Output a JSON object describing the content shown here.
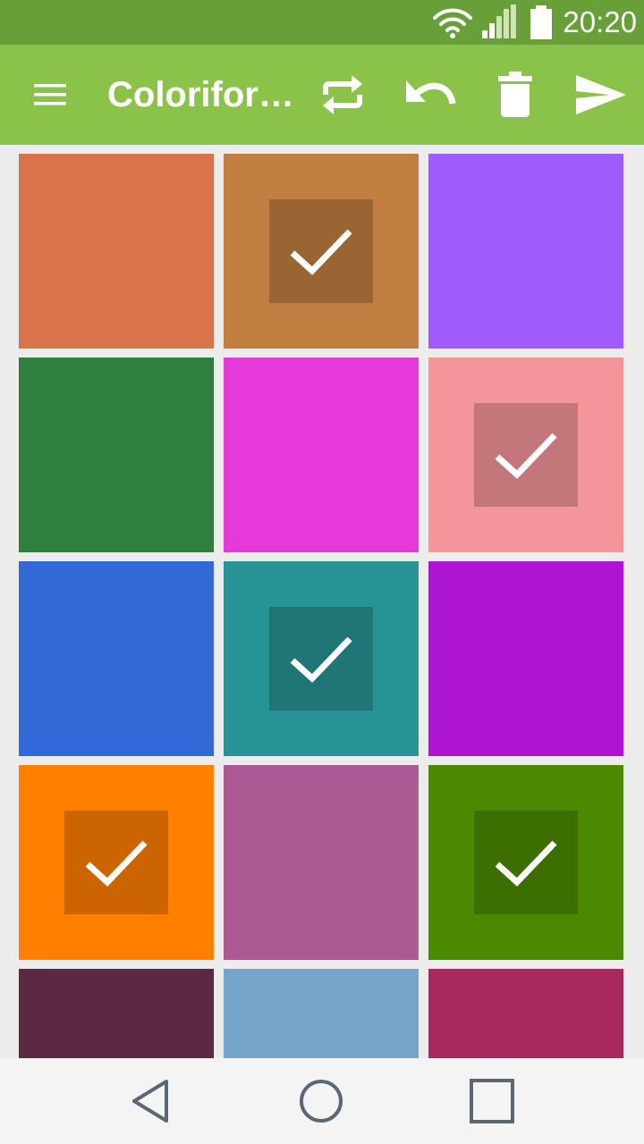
{
  "status_bar": {
    "time": "20:20",
    "icons": [
      "wifi-icon",
      "signal-icon",
      "battery-icon"
    ]
  },
  "app_bar": {
    "title": "Coloriform…",
    "actions": [
      "menu-icon",
      "swap-icon",
      "undo-icon",
      "delete-icon",
      "send-icon"
    ]
  },
  "colors": {
    "status_bar": "#689f38",
    "app_bar": "#8bc34a",
    "background": "#ececec",
    "nav_bar": "#f4f4f4",
    "nav_icon": "#5a6775"
  },
  "swatches": [
    {
      "color": "#d9734a",
      "selected": false
    },
    {
      "color": "#c07f40",
      "selected": true
    },
    {
      "color": "#a05cfb",
      "selected": false
    },
    {
      "color": "#2f7f3f",
      "selected": false
    },
    {
      "color": "#e539d9",
      "selected": false
    },
    {
      "color": "#f4959a",
      "selected": true
    },
    {
      "color": "#3268d8",
      "selected": false
    },
    {
      "color": "#289395",
      "selected": true
    },
    {
      "color": "#ad15d3",
      "selected": false
    },
    {
      "color": "#ff7f00",
      "selected": true
    },
    {
      "color": "#ab5a94",
      "selected": false
    },
    {
      "color": "#4b8a00",
      "selected": true
    },
    {
      "color": "#5c2942",
      "selected": false
    },
    {
      "color": "#76a5cc",
      "selected": false
    },
    {
      "color": "#a7295e",
      "selected": false
    }
  ],
  "nav_bar": {
    "buttons": [
      "back-icon",
      "home-icon",
      "recents-icon"
    ]
  }
}
